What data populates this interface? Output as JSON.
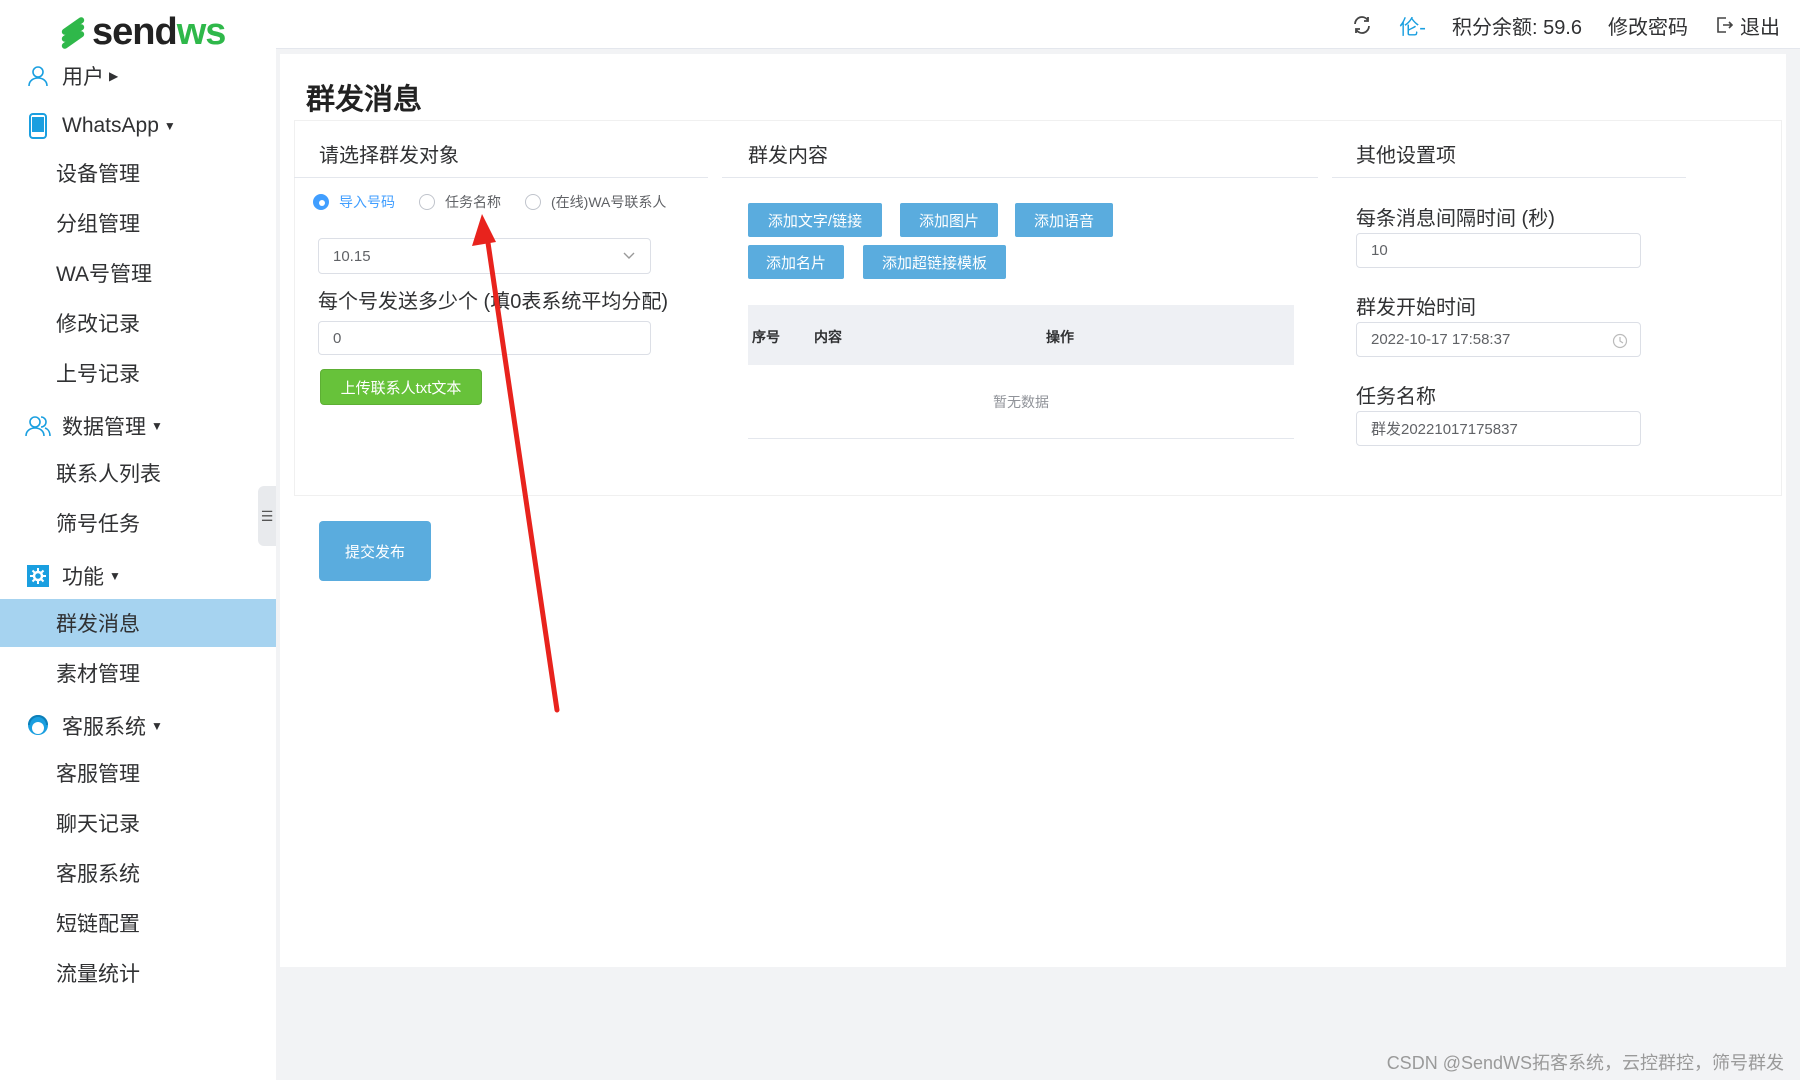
{
  "brand": {
    "left": "send",
    "right": "ws"
  },
  "topbar": {
    "user": "伦-",
    "points": "积分余额: 59.6",
    "change_password": "修改密码",
    "logout": "退出"
  },
  "sidebar": {
    "sections": [
      {
        "label": "用户",
        "icon": "user-icon"
      },
      {
        "label": "WhatsApp",
        "icon": "phone-icon"
      },
      {
        "label": "数据管理",
        "icon": "users-icon"
      },
      {
        "label": "功能",
        "icon": "gear-icon"
      },
      {
        "label": "客服系统",
        "icon": "headset-icon"
      }
    ],
    "whatsapp_items": [
      "设备管理",
      "分组管理",
      "WA号管理",
      "修改记录",
      "上号记录"
    ],
    "data_items": [
      "联系人列表",
      "筛号任务"
    ],
    "feature_items": [
      "群发消息",
      "素材管理"
    ],
    "cs_items": [
      "客服管理",
      "聊天记录",
      "客服系统",
      "短链配置",
      "流量统计"
    ]
  },
  "page": {
    "title": "群发消息"
  },
  "target": {
    "title": "请选择群发对象",
    "radios": [
      "导入号码",
      "任务名称",
      "(在线)WA号联系人"
    ],
    "selected_radio": "导入号码",
    "group_select_value": "10.15",
    "per_number_label": "每个号发送多少个 (填0表系统平均分配)",
    "per_number_value": "0",
    "upload_button": "上传联系人txt文本"
  },
  "content": {
    "title": "群发内容",
    "buttons": [
      "添加文字/链接",
      "添加图片",
      "添加语音",
      "添加名片",
      "添加超链接模板"
    ],
    "table_headers": [
      "序号",
      "内容",
      "操作"
    ],
    "empty_text": "暂无数据"
  },
  "settings": {
    "title": "其他设置项",
    "interval_label": "每条消息间隔时间 (秒)",
    "interval_value": "10",
    "start_label": "群发开始时间",
    "start_value": "2022-10-17 17:58:37",
    "task_label": "任务名称",
    "task_value": "群发20221017175837"
  },
  "submit_button": "提交发布",
  "footer": "CSDN @SendWS拓客系统，云控群控，筛号群发",
  "colors": {
    "accent": "#409eff",
    "button_blue": "#5aacde",
    "green": "#67c23a",
    "active_menu": "#a6d3f0",
    "annotation": "#e8231d"
  }
}
